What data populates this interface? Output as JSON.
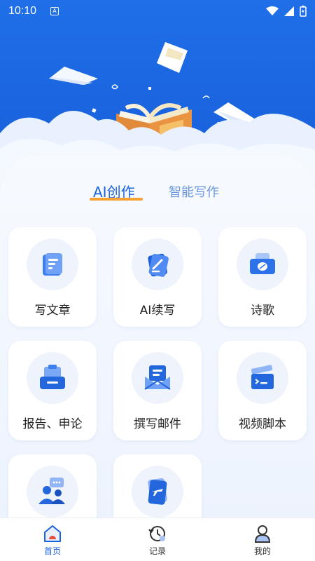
{
  "status_bar": {
    "time": "10:10",
    "notification_icon": "a-letter-icon",
    "wifi_icon": "wifi-icon",
    "signal_icon": "signal-icon",
    "battery_icon": "battery-icon"
  },
  "hero": {
    "illustration": "open-book-with-flying-pages"
  },
  "tabs": [
    {
      "label": "AI创作",
      "active": true
    },
    {
      "label": "智能写作",
      "active": false
    }
  ],
  "features": [
    {
      "label": "写文章",
      "icon": "article-icon"
    },
    {
      "label": "AI续写",
      "icon": "continue-writing-icon"
    },
    {
      "label": "诗歌",
      "icon": "poetry-icon"
    },
    {
      "label": "报告、申论",
      "icon": "report-icon"
    },
    {
      "label": "撰写邮件",
      "icon": "email-icon"
    },
    {
      "label": "视频脚本",
      "icon": "video-script-icon"
    },
    {
      "label": "",
      "icon": "chat-people-icon"
    },
    {
      "label": "",
      "icon": "travel-ticket-icon"
    }
  ],
  "bottom_nav": [
    {
      "label": "首页",
      "icon": "home-icon",
      "active": true
    },
    {
      "label": "记录",
      "icon": "history-icon",
      "active": false
    },
    {
      "label": "我的",
      "icon": "profile-icon",
      "active": false
    }
  ],
  "colors": {
    "primary": "#1b63de",
    "accent": "#f5a233",
    "tab_inactive": "#6c97dc"
  }
}
